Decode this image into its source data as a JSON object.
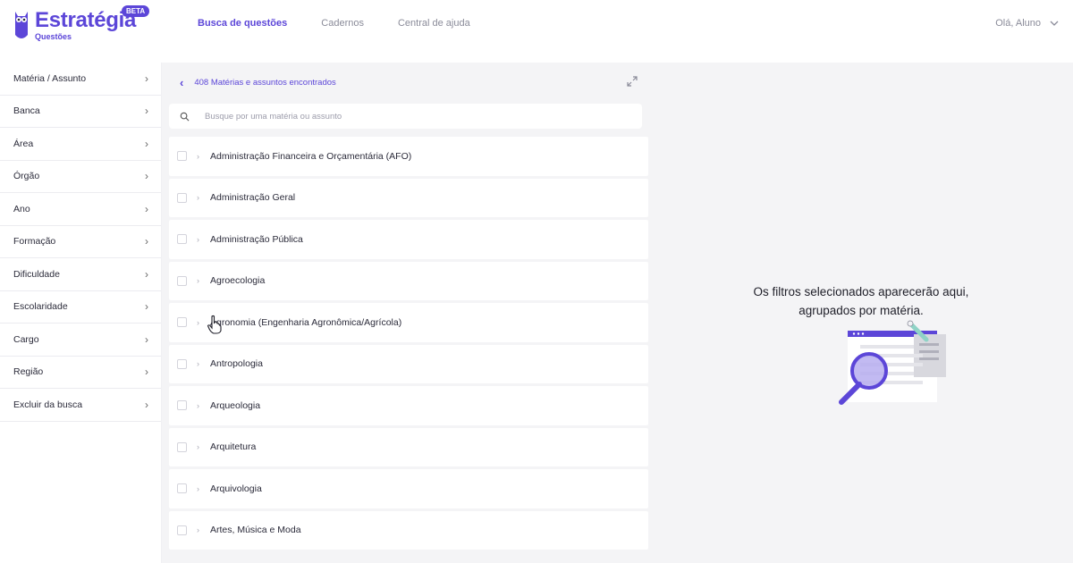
{
  "header": {
    "brand": "Estratégia",
    "brand_sub": "Questões",
    "beta_badge": "BETA",
    "nav": [
      {
        "label": "Busca de questões",
        "active": true
      },
      {
        "label": "Cadernos",
        "active": false
      },
      {
        "label": "Central de ajuda",
        "active": false
      }
    ],
    "user_greeting": "Olá, Aluno"
  },
  "sidebar": {
    "items": [
      {
        "label": "Matéria / Assunto"
      },
      {
        "label": "Banca"
      },
      {
        "label": "Área"
      },
      {
        "label": "Órgão"
      },
      {
        "label": "Ano"
      },
      {
        "label": "Formação"
      },
      {
        "label": "Dificuldade"
      },
      {
        "label": "Escolaridade"
      },
      {
        "label": "Cargo"
      },
      {
        "label": "Região"
      },
      {
        "label": "Excluir da busca"
      }
    ]
  },
  "middle": {
    "found_text": "408 Matérias e assuntos encontrados",
    "search_placeholder": "Busque por uma matéria ou assunto",
    "subjects": [
      {
        "label": "Administração Financeira e Orçamentária (AFO)"
      },
      {
        "label": "Administração Geral"
      },
      {
        "label": "Administração Pública"
      },
      {
        "label": "Agroecologia"
      },
      {
        "label": "Agronomia (Engenharia Agronômica/Agrícola)"
      },
      {
        "label": "Antropologia"
      },
      {
        "label": "Arqueologia"
      },
      {
        "label": "Arquitetura"
      },
      {
        "label": "Arquivologia"
      },
      {
        "label": "Artes, Música e Moda"
      }
    ]
  },
  "right": {
    "empty_line1": "Os filtros selecionados aparecerão aqui,",
    "empty_line2": "agrupados por matéria."
  },
  "icons": {
    "back": "chevron-left-icon",
    "expand": "expand-icon",
    "search": "search-icon",
    "sidebar_arrow": "chevron-right-icon",
    "user_menu": "chevron-down-icon"
  },
  "colors": {
    "brand": "#5c46d8",
    "panel_bg": "#f4f4f6",
    "nav_inactive": "#8a8b99"
  }
}
